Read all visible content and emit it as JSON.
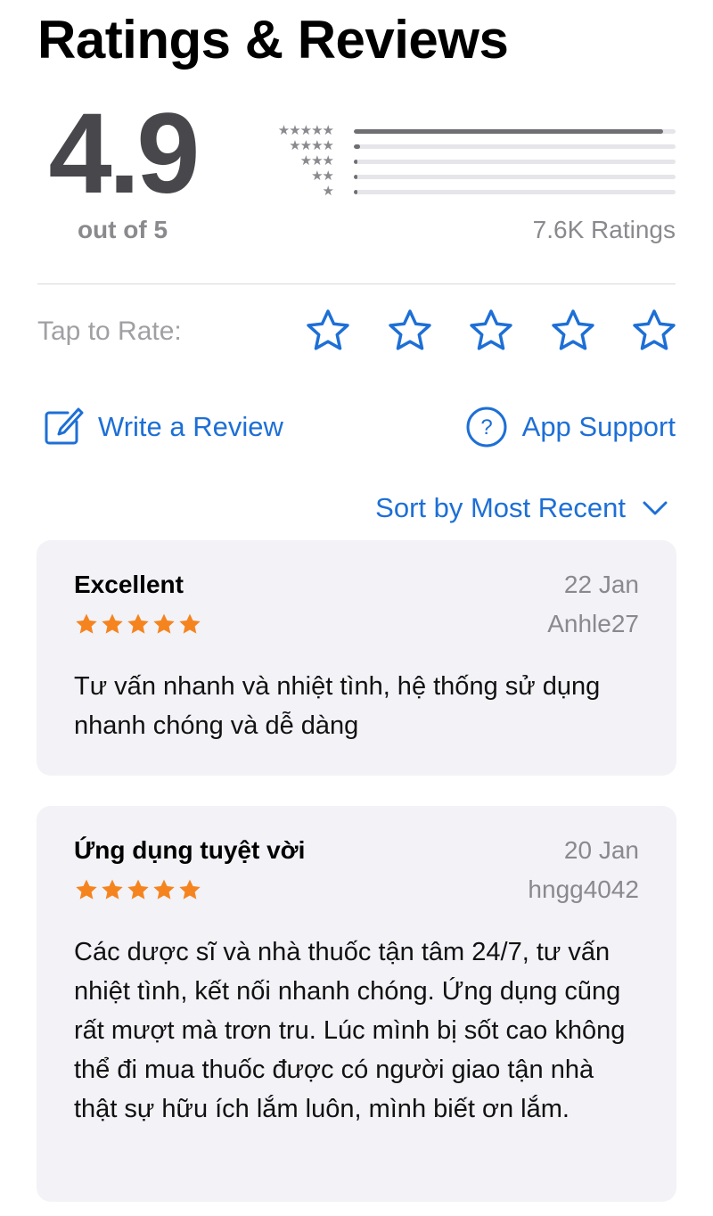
{
  "header": {
    "title": "Ratings & Reviews"
  },
  "summary": {
    "average": "4.9",
    "out_of": "out of 5",
    "ratings_count": "7.6K Ratings",
    "distribution": [
      {
        "stars": 5,
        "label": "★★★★★",
        "fraction": 0.96
      },
      {
        "stars": 4,
        "label": "★★★★",
        "fraction": 0.02
      },
      {
        "stars": 3,
        "label": "★★★",
        "fraction": 0.005
      },
      {
        "stars": 2,
        "label": "★★",
        "fraction": 0.005
      },
      {
        "stars": 1,
        "label": "★",
        "fraction": 0.01
      }
    ]
  },
  "tap_to_rate": {
    "label": "Tap to Rate:",
    "star_count": 5,
    "selected": 0
  },
  "actions": {
    "write_review": {
      "label": "Write a Review",
      "icon": "compose-icon"
    },
    "app_support": {
      "label": "App Support",
      "icon": "question-circle-icon"
    }
  },
  "sort": {
    "label": "Sort by Most Recent",
    "icon": "chevron-down-icon"
  },
  "colors": {
    "accent": "#1d6fd6",
    "star_orange": "#f5841f",
    "bar_fill": "#6e6e73",
    "bar_track": "#e5e5ea",
    "card_bg": "#f2f2f7",
    "secondary_text": "#8a8a8e"
  },
  "reviews": [
    {
      "title": "Excellent",
      "date": "22 Jan",
      "author": "Anhle27",
      "rating": 5,
      "body": "Tư vấn nhanh và nhiệt tình, hệ thống sử dụng nhanh chóng và dễ dàng"
    },
    {
      "title": "Ứng dụng tuyệt vời",
      "date": "20 Jan",
      "author": "hngg4042",
      "rating": 5,
      "body": "Các dược sĩ và nhà thuốc tận tâm 24/7, tư vấn nhiệt tình, kết nối nhanh chóng. Ứng dụng cũng rất mượt mà trơn tru. Lúc mình bị sốt cao không thể đi mua thuốc được có người giao tận nhà thật sự hữu ích lắm luôn, mình biết ơn lắm."
    }
  ]
}
